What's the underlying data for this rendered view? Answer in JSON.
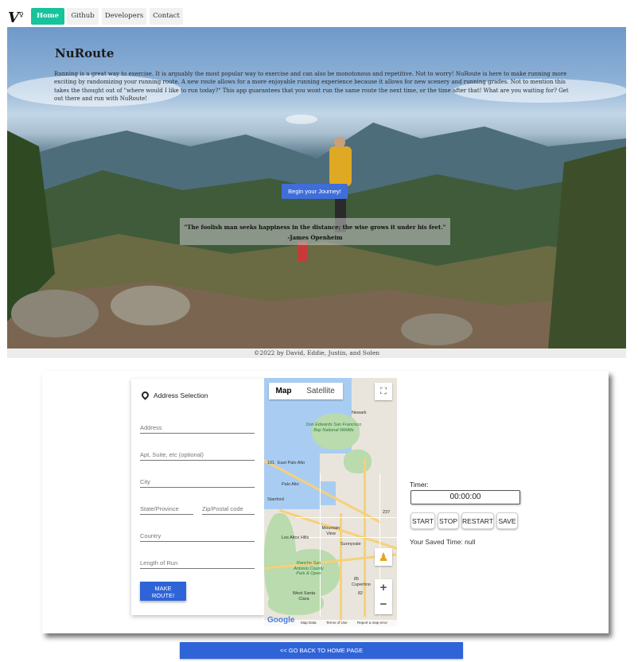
{
  "nav": {
    "logo": "V",
    "items": [
      {
        "label": "Home",
        "active": true
      },
      {
        "label": "Github",
        "active": false
      },
      {
        "label": "Developers",
        "active": false
      },
      {
        "label": "Contact",
        "active": false
      }
    ],
    "accent_color": "#16c39a"
  },
  "hero": {
    "title": "NuRoute",
    "description": "Running is a great way to exercise. It is arguably the most popular way to exercise and can also be monotonous and repetitive. Not to worry! NuRoute is here to make running more exciting by randomizing your running route. A new route allows for a more enjoyable running experience because it allows for new scenery and running grades. Not to mention this takes the thought out of \"where would I like to run today?\" This app guarantees that you wont run the same route the next time, or the time after that! What are you waiting for? Get out there and run with NuRoute!",
    "cta_label": "Begin your Journey!",
    "quote": "\"The foolish man seeks happiness in the distance; the wise grows it under his feet.\"",
    "quote_author": "-James Openheim"
  },
  "footer": {
    "copyright": "©2022 by David, Eddie, Justin, and Solen"
  },
  "address_form": {
    "heading": "Address Selection",
    "heading_icon": "location-pin-icon",
    "fields": {
      "address": {
        "placeholder": "Address",
        "value": ""
      },
      "apt": {
        "placeholder": "Apt, Suite, etc (optional)",
        "value": ""
      },
      "city": {
        "placeholder": "City",
        "value": ""
      },
      "state": {
        "placeholder": "State/Province",
        "value": ""
      },
      "zip": {
        "placeholder": "Zip/Postal code",
        "value": ""
      },
      "country": {
        "placeholder": "Country",
        "value": ""
      },
      "length": {
        "placeholder": "Length of Run",
        "value": ""
      }
    },
    "submit_line1": "MAKE",
    "submit_line2": "ROUTE!"
  },
  "map": {
    "tabs": [
      "Map",
      "Satellite"
    ],
    "active_tab": "Map",
    "labels": {
      "newark": "Newark",
      "refuge": "Don Edwards San Francisco Bay National Wildlife",
      "epa": "East Palo Alto",
      "palo_alto": "Palo Alto",
      "stanford": "Stanford",
      "mountain_view": "Mountain View",
      "los_altos_hills": "Los Altos Hills",
      "sunnyvale": "Sunnyvale",
      "rancho": "Rancho San Antonio County Park & Open",
      "cupertino": "Cupertino",
      "west_santa_clara": "West Santa Clara",
      "route_101": "101",
      "route_237": "237",
      "route_85": "85",
      "route_82": "82"
    },
    "footer": {
      "google": "Google",
      "map_data": "Map Data",
      "terms": "Terms of Use",
      "report": "Report a map error"
    }
  },
  "timer": {
    "label": "Timer:",
    "display": "00:00:00",
    "buttons": [
      "START",
      "STOP",
      "RESTART",
      "SAVE"
    ],
    "saved_text": "Your Saved Time: null"
  },
  "back_button": "<< GO BACK TO HOME PAGE"
}
